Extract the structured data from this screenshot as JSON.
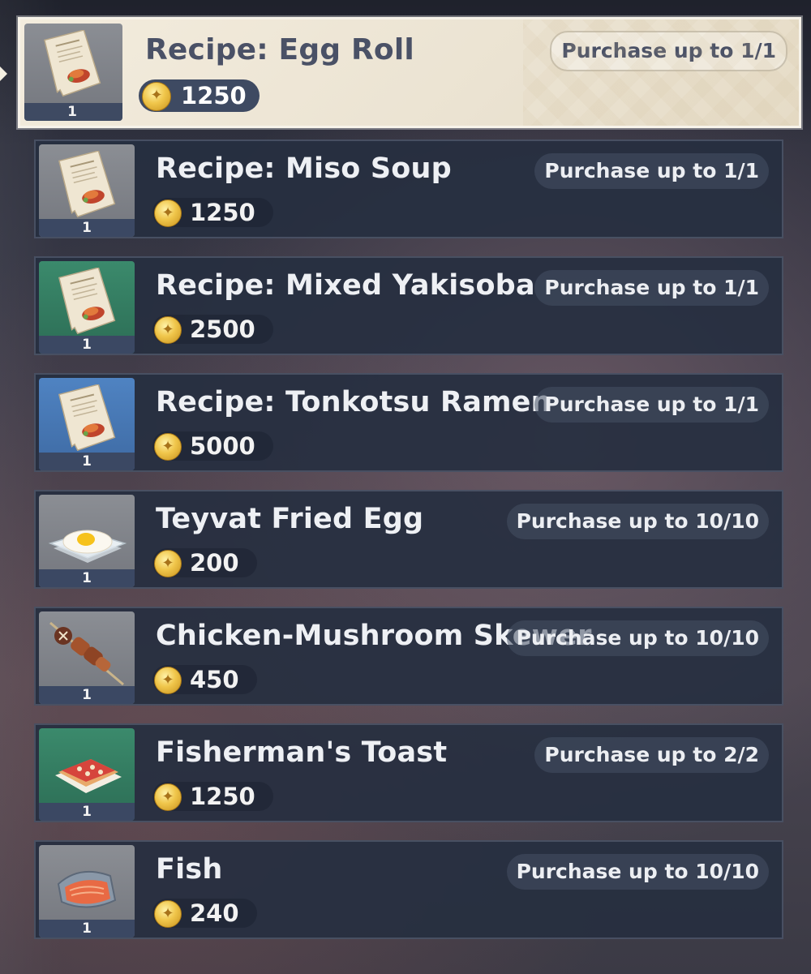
{
  "items": [
    {
      "name": "Recipe: Egg Roll",
      "price": "1250",
      "limit": "Purchase up to 1/1",
      "count": "1",
      "icon": "recipe-scroll-icon",
      "thumb_color": "grey",
      "selected": true
    },
    {
      "name": "Recipe: Miso Soup",
      "price": "1250",
      "limit": "Purchase up to 1/1",
      "count": "1",
      "icon": "recipe-scroll-icon",
      "thumb_color": "grey",
      "selected": false
    },
    {
      "name": "Recipe: Mixed Yakisoba",
      "price": "2500",
      "limit": "Purchase up to 1/1",
      "count": "1",
      "icon": "recipe-scroll-icon",
      "thumb_color": "green",
      "selected": false
    },
    {
      "name": "Recipe: Tonkotsu Ramen",
      "price": "5000",
      "limit": "Purchase up to 1/1",
      "count": "1",
      "icon": "recipe-scroll-icon",
      "thumb_color": "blue",
      "selected": false
    },
    {
      "name": "Teyvat Fried Egg",
      "price": "200",
      "limit": "Purchase up to 10/10",
      "count": "1",
      "icon": "fried-egg-icon",
      "thumb_color": "grey",
      "selected": false
    },
    {
      "name": "Chicken-Mushroom Skewer",
      "price": "450",
      "limit": "Purchase up to 10/10",
      "count": "1",
      "icon": "skewer-icon",
      "thumb_color": "grey",
      "selected": false
    },
    {
      "name": "Fisherman's Toast",
      "price": "1250",
      "limit": "Purchase up to 2/2",
      "count": "1",
      "icon": "toast-icon",
      "thumb_color": "green",
      "selected": false
    },
    {
      "name": "Fish",
      "price": "240",
      "limit": "Purchase up to 10/10",
      "count": "1",
      "icon": "fish-icon",
      "thumb_color": "grey",
      "selected": false
    }
  ],
  "currency_icon": "mora-coin-icon"
}
